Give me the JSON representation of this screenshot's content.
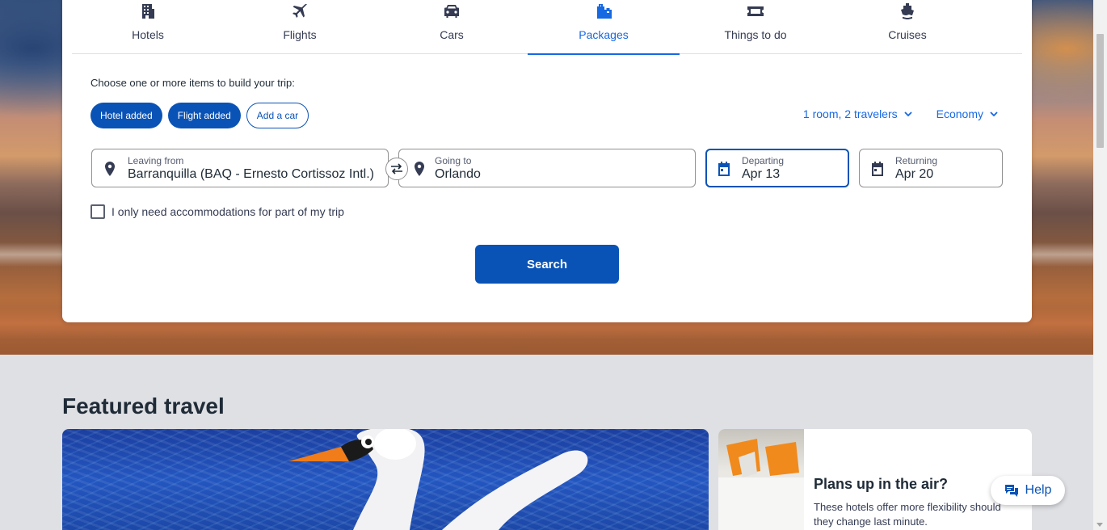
{
  "tabs": [
    {
      "label": "Hotels",
      "icon": "hotel-icon"
    },
    {
      "label": "Flights",
      "icon": "airplane-icon"
    },
    {
      "label": "Cars",
      "icon": "car-icon"
    },
    {
      "label": "Packages",
      "icon": "luggage-icon",
      "active": true
    },
    {
      "label": "Things to do",
      "icon": "ticket-icon"
    },
    {
      "label": "Cruises",
      "icon": "cruise-ship-icon"
    }
  ],
  "builder": {
    "prompt": "Choose one or more items to build your trip:",
    "chips": [
      {
        "label": "Hotel added",
        "state": "added"
      },
      {
        "label": "Flight added",
        "state": "added"
      },
      {
        "label": "Add a car",
        "state": "not-added"
      }
    ],
    "travelers": "1 room, 2 travelers",
    "cabin_class": "Economy"
  },
  "fields": {
    "leaving_from": {
      "label": "Leaving from",
      "value": "Barranquilla (BAQ - Ernesto Cortissoz Intl.)"
    },
    "going_to": {
      "label": "Going to",
      "value": "Orlando"
    },
    "departing": {
      "label": "Departing",
      "value": "Apr 13"
    },
    "returning": {
      "label": "Returning",
      "value": "Apr 20"
    }
  },
  "partial_stay": {
    "label": "I only need accommodations for part of my trip",
    "checked": false
  },
  "search_label": "Search",
  "featured": {
    "title": "Featured travel",
    "side_title": "Plans up in the air?",
    "side_text": "These hotels offer more flexibility should they change last minute."
  },
  "help_label": "Help",
  "colors": {
    "accent": "#1668e3",
    "button": "#0a53b6",
    "page_bg": "#dfe0e4"
  }
}
